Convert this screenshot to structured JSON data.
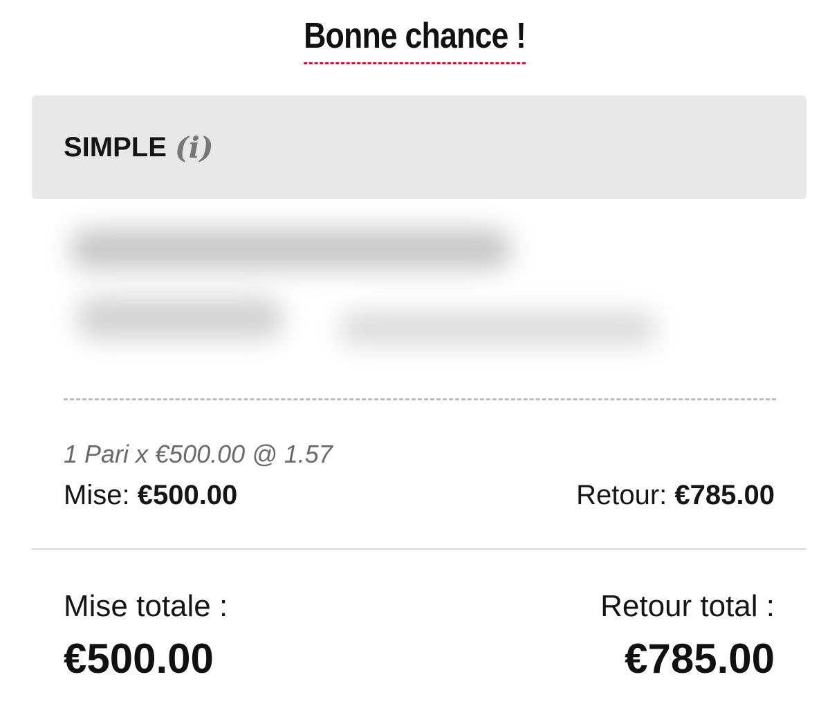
{
  "header": {
    "title": "Bonne chance !"
  },
  "bet": {
    "type_label": "SIMPLE",
    "info_open": "(",
    "info_glyph": "i",
    "info_close": ")",
    "summary": "1 Pari x €500.00 @ 1.57",
    "stake_label": "Mise:",
    "stake_value": "€500.00",
    "return_label": "Retour:",
    "return_value": "€785.00"
  },
  "totals": {
    "total_stake_label": "Mise totale :",
    "total_return_label": "Retour total :",
    "total_stake_value": "€500.00",
    "total_return_value": "€785.00"
  },
  "colors": {
    "accent_dashed_underline": "#d0103a",
    "header_background": "#e8e8e8"
  }
}
